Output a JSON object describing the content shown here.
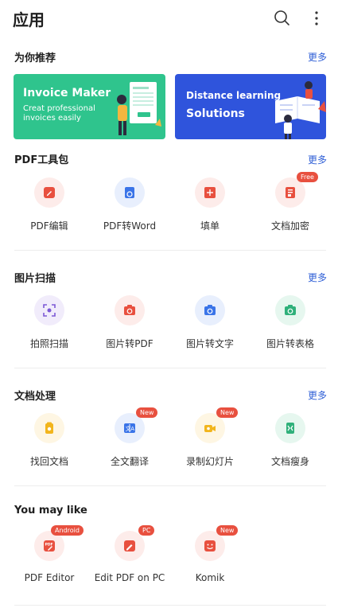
{
  "header": {
    "title": "应用",
    "search_icon": "search-icon",
    "more_icon": "more-vertical-icon"
  },
  "recommend": {
    "title": "为你推荐",
    "more": "更多",
    "banners": [
      {
        "title": "Invoice Maker",
        "subtitle_line1": "Creat professional",
        "subtitle_line2": "invoices easily",
        "color": "#2fc48d"
      },
      {
        "title_line1": "Distance learning",
        "title_line2": "Solutions",
        "color": "#2f54dc"
      }
    ]
  },
  "pdf_tools": {
    "title": "PDF工具包",
    "more": "更多",
    "items": [
      {
        "label": "PDF编辑",
        "icon": "pdf-edit-icon"
      },
      {
        "label": "PDF转Word",
        "icon": "pdf-to-word-icon"
      },
      {
        "label": "填单",
        "icon": "fill-form-icon"
      },
      {
        "label": "文档加密",
        "icon": "doc-encrypt-icon",
        "badge": "Free"
      }
    ]
  },
  "image_scan": {
    "title": "图片扫描",
    "more": "更多",
    "items": [
      {
        "label": "拍照扫描",
        "icon": "scan-icon"
      },
      {
        "label": "图片转PDF",
        "icon": "image-to-pdf-icon"
      },
      {
        "label": "图片转文字",
        "icon": "image-to-text-icon"
      },
      {
        "label": "图片转表格",
        "icon": "image-to-table-icon"
      }
    ]
  },
  "doc_process": {
    "title": "文档处理",
    "more": "更多",
    "items": [
      {
        "label": "找回文档",
        "icon": "recover-doc-icon"
      },
      {
        "label": "全文翻译",
        "icon": "translate-icon",
        "badge": "New"
      },
      {
        "label": "录制幻灯片",
        "icon": "record-slides-icon",
        "badge": "New"
      },
      {
        "label": "文档瘦身",
        "icon": "slim-doc-icon"
      }
    ]
  },
  "you_may_like": {
    "title": "You may like",
    "items": [
      {
        "label": "PDF Editor",
        "icon": "pdf-editor-app-icon",
        "badge": "Android"
      },
      {
        "label": "Edit PDF on PC",
        "icon": "edit-pdf-pc-icon",
        "badge": "PC"
      },
      {
        "label": "Komik",
        "icon": "komik-icon",
        "badge": "New"
      }
    ]
  }
}
